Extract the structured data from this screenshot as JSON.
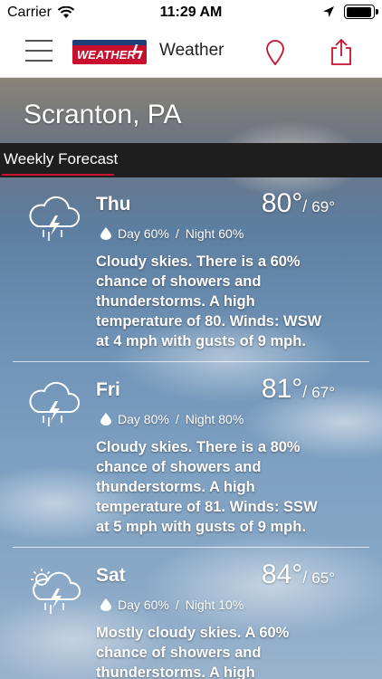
{
  "status_bar": {
    "carrier": "Carrier",
    "time": "11:29 AM",
    "battery_level": 0.95
  },
  "nav": {
    "logo_text": "WEATHER",
    "title": "Weather",
    "menu_icon": "hamburger-icon",
    "pin_icon": "map-pin-icon",
    "share_icon": "share-icon"
  },
  "location": {
    "city": "Scranton, PA"
  },
  "section": {
    "title": "Weekly Forecast"
  },
  "days": [
    {
      "name": "Thu",
      "high": "80°",
      "low": "69°",
      "day_precip": "Day 60%",
      "sep": "/",
      "night_precip": "Night 60%",
      "desc_lines": [
        "Cloudy skies. There is a 60%",
        "chance of showers and",
        "thunderstorms.  A high",
        "temperature of 80.  Winds: WSW",
        "at 4 mph with gusts of 9 mph."
      ],
      "icon": "thunderstorm-icon"
    },
    {
      "name": "Fri",
      "high": "81°",
      "low": "67°",
      "day_precip": "Day 80%",
      "sep": "/",
      "night_precip": "Night 80%",
      "desc_lines": [
        "Cloudy skies. There is a 80%",
        "chance of showers and",
        "thunderstorms.  A high",
        "temperature of 81.  Winds: SSW",
        "at 5 mph with gusts of 9 mph."
      ],
      "icon": "thunderstorm-icon"
    },
    {
      "name": "Sat",
      "high": "84°",
      "low": "65°",
      "day_precip": "Day 60%",
      "sep": "/",
      "night_precip": "Night 10%",
      "desc_lines": [
        "Mostly cloudy skies.  A 60%",
        "chance of showers and",
        "thunderstorms.  A high"
      ],
      "icon": "sun-thunderstorm-icon"
    }
  ],
  "colors": {
    "accent": "#c8102e",
    "section_bar": "#1e1e1e"
  }
}
